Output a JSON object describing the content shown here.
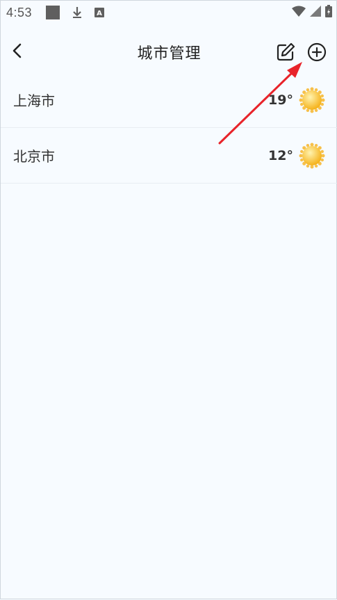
{
  "status_bar": {
    "time": "4:53",
    "icons": [
      "notification-square-icon",
      "download-icon",
      "keyboard-a-icon",
      "wifi-icon",
      "signal-icon",
      "battery-icon"
    ]
  },
  "header": {
    "title": "城市管理",
    "back_icon": "chevron-left-icon",
    "edit_icon": "edit-pencil-icon",
    "add_icon": "plus-circle-icon"
  },
  "cities": [
    {
      "name": "上海市",
      "temperature": "19°",
      "weather_icon": "sun-icon"
    },
    {
      "name": "北京市",
      "temperature": "12°",
      "weather_icon": "sun-icon"
    }
  ],
  "colors": {
    "background": "#f7fbff",
    "sun": "#fbc02d",
    "annotation_arrow": "#e8232a"
  }
}
